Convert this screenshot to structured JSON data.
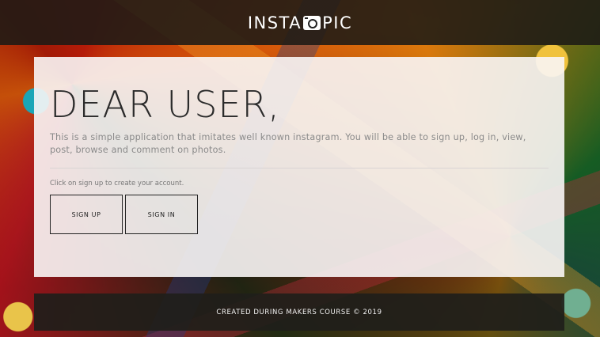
{
  "header": {
    "logo_left": "INSTA",
    "logo_icon": "camera-icon",
    "logo_right": "PIC"
  },
  "hero": {
    "title": "DEAR USER,",
    "description": "This is a simple application that imitates well known instagram. You will be able to sign up, log in, view, post, browse and comment on photos.",
    "hint": "Click on sign up to create your account."
  },
  "buttons": {
    "sign_up": "SIGN UP",
    "sign_in": "SIGN IN"
  },
  "footer": {
    "text": "CREATED DURING MAKERS COURSE © 2019"
  },
  "colors": {
    "panel_bg": "#faf6f6",
    "bar_bg": "#1c1a16",
    "text_dark": "#2b2b2b",
    "text_muted": "#8a8a8a"
  }
}
